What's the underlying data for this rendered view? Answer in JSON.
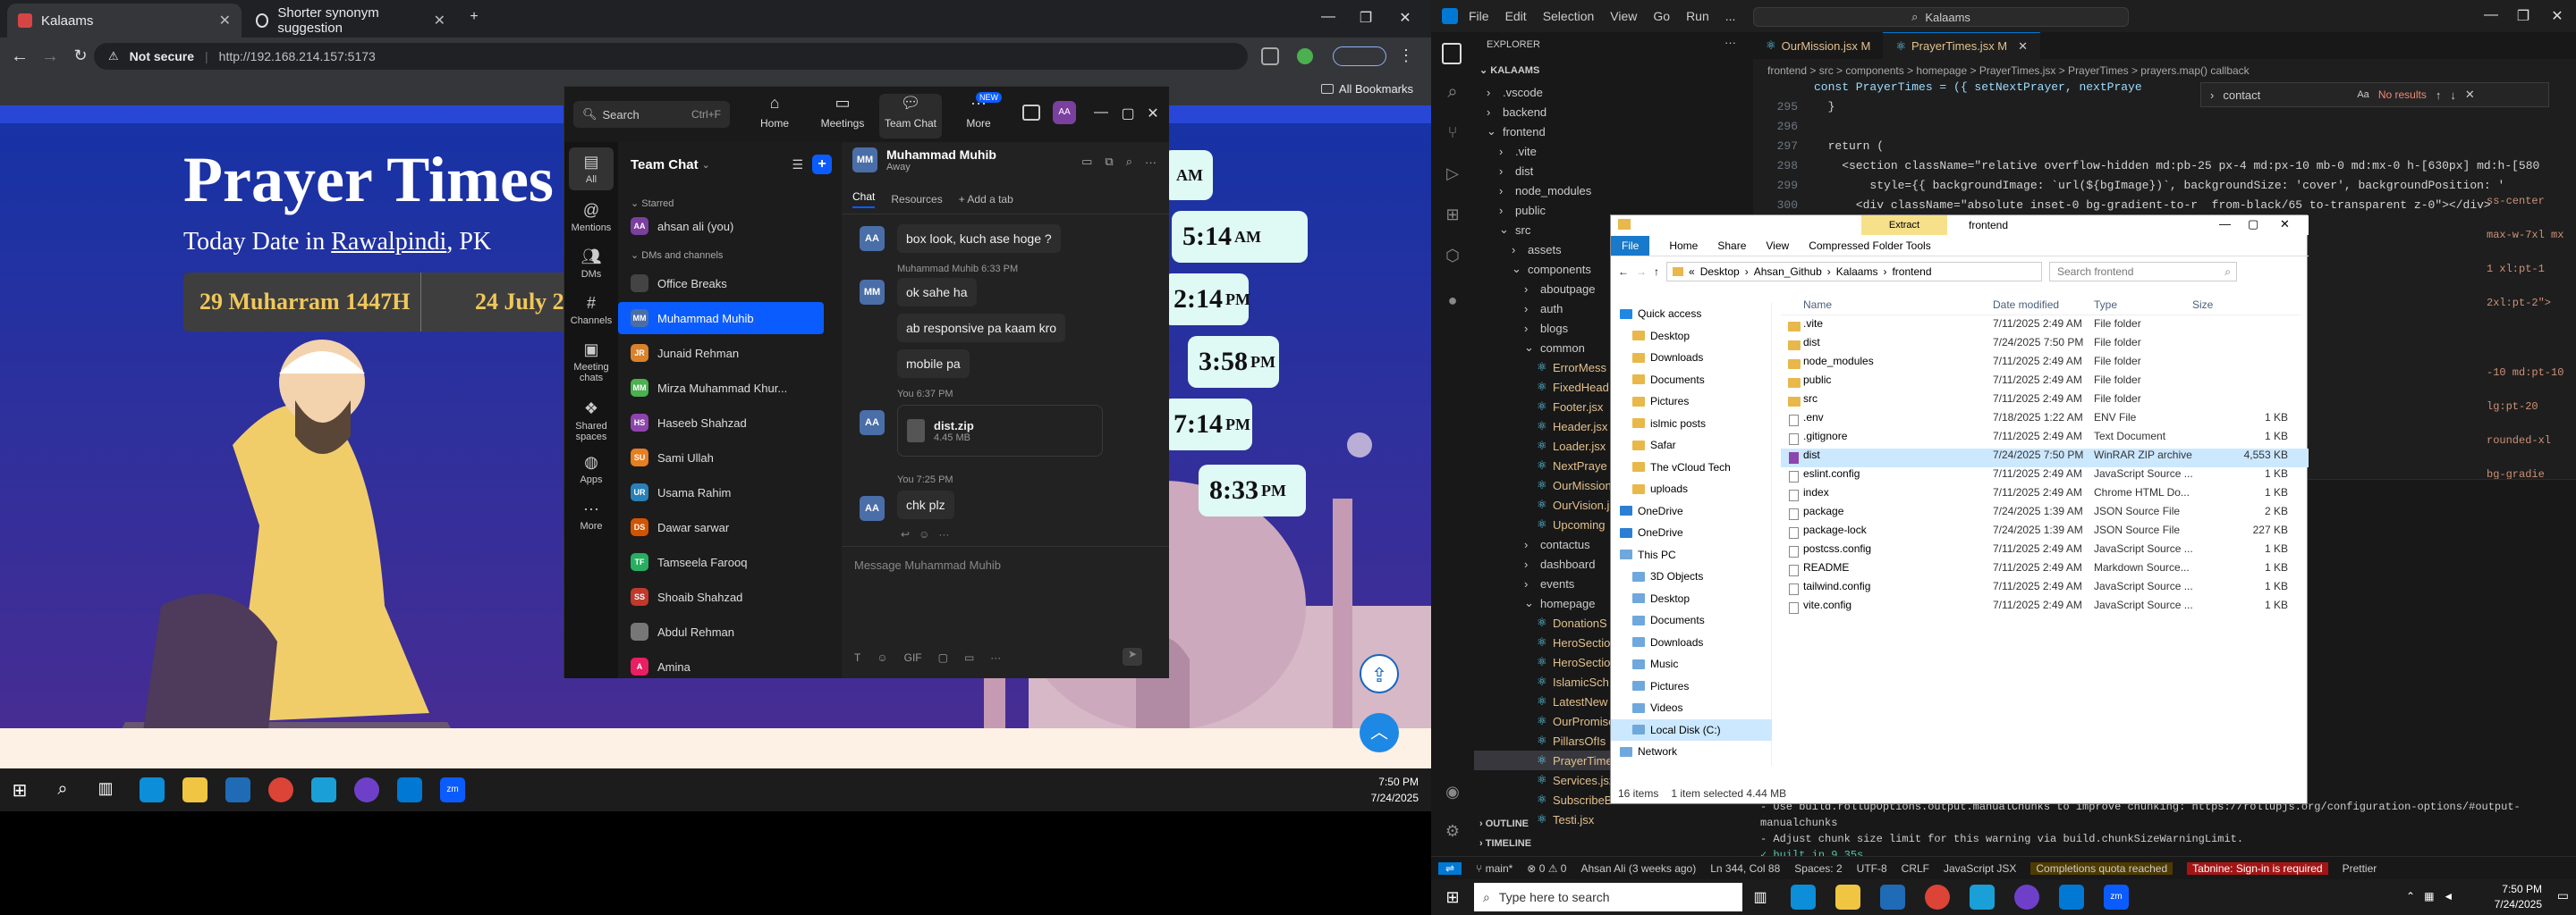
{
  "chrome": {
    "tabs": [
      {
        "title": "Kalaams",
        "active": true
      },
      {
        "title": "Shorter synonym suggestion",
        "active": false
      }
    ],
    "not_secure": "Not secure",
    "url": "http://192.168.214.157:5173",
    "all_bookmarks": "All Bookmarks"
  },
  "site": {
    "title": "Prayer Times",
    "date_prefix": "Today Date in ",
    "city": "Rawalpindi",
    "country": ", PK",
    "hijri": "29 Muharram 1447H",
    "gregorian": "24 July 2",
    "times": [
      {
        "t": "",
        "ampm": "AM"
      },
      {
        "t": "5:14",
        "ampm": "AM"
      },
      {
        "t": "2:14",
        "ampm": "PM"
      },
      {
        "t": "3:58",
        "ampm": "PM"
      },
      {
        "t": "7:14",
        "ampm": "PM"
      },
      {
        "t": "8:33",
        "ampm": "PM"
      }
    ]
  },
  "zoom": {
    "search": "Search",
    "search_shortcut": "Ctrl+F",
    "nav": [
      "Home",
      "Meetings",
      "Team Chat",
      "More"
    ],
    "new_badge": "NEW",
    "rail": [
      "All",
      "Mentions",
      "DMs",
      "Channels",
      "Meeting chats",
      "Shared spaces",
      "Apps",
      "More"
    ],
    "list_title": "Team Chat",
    "starred": "Starred",
    "me": "ahsan ali (you)",
    "dms_channels": "DMs and channels",
    "contacts": [
      {
        "name": "Office Breaks",
        "initials": "",
        "color": "#444"
      },
      {
        "name": "Muhammad Muhib",
        "initials": "MM",
        "color": "#4a6ea8"
      },
      {
        "name": "Junaid Rehman",
        "initials": "JR",
        "color": "#d9822b"
      },
      {
        "name": "Mirza Muhammad Khur...",
        "initials": "MM",
        "color": "#4caf50"
      },
      {
        "name": "Haseeb Shahzad",
        "initials": "HS",
        "color": "#8e44ad"
      },
      {
        "name": "Sami Ullah",
        "initials": "SU",
        "color": "#e67e22"
      },
      {
        "name": "Usama Rahim",
        "initials": "UR",
        "color": "#2980b9"
      },
      {
        "name": "Dawar sarwar",
        "initials": "DS",
        "color": "#d35400"
      },
      {
        "name": "Tamseela Farooq",
        "initials": "TF",
        "color": "#27ae60"
      },
      {
        "name": "Shoaib Shahzad",
        "initials": "SS",
        "color": "#c0392b"
      },
      {
        "name": "Abdul Rehman",
        "initials": "",
        "color": "#777"
      },
      {
        "name": "Amina",
        "initials": "A",
        "color": "#e91e63"
      }
    ],
    "chat_name": "Muhammad Muhib",
    "chat_status": "Away",
    "chat_tabs": [
      "Chat",
      "Resources",
      "Add a tab"
    ],
    "messages": [
      {
        "text": "box look, kuch ase hoge ?"
      },
      {
        "meta": "Muhammad Muhib 6:33 PM"
      },
      {
        "text": "ok sahe ha"
      },
      {
        "text": "ab responsive pa kaam kro"
      },
      {
        "text": "mobile pa"
      },
      {
        "meta": "You 6:37 PM"
      },
      {
        "file": "dist.zip",
        "size": "4.45 MB"
      },
      {
        "meta": "You 7:25 PM"
      },
      {
        "text": "chk plz"
      }
    ],
    "composer": "Message Muhammad Muhib"
  },
  "vscode": {
    "menu": [
      "File",
      "Edit",
      "Selection",
      "View",
      "Go",
      "Run",
      "..."
    ],
    "command": "Kalaams",
    "explorer_title": "EXPLORER",
    "root": "KALAAMS",
    "tree": [
      {
        "n": ".vscode",
        "d": 1,
        "f": true
      },
      {
        "n": "backend",
        "d": 1,
        "f": true
      },
      {
        "n": "frontend",
        "d": 1,
        "f": true,
        "open": true
      },
      {
        "n": ".vite",
        "d": 2,
        "f": true
      },
      {
        "n": "dist",
        "d": 2,
        "f": true
      },
      {
        "n": "node_modules",
        "d": 2,
        "f": true
      },
      {
        "n": "public",
        "d": 2,
        "f": true
      },
      {
        "n": "src",
        "d": 2,
        "f": true,
        "open": true
      },
      {
        "n": "assets",
        "d": 3,
        "f": true
      },
      {
        "n": "components",
        "d": 3,
        "f": true,
        "open": true
      },
      {
        "n": "aboutpage",
        "d": 4,
        "f": true
      },
      {
        "n": "auth",
        "d": 4,
        "f": true
      },
      {
        "n": "blogs",
        "d": 4,
        "f": true
      },
      {
        "n": "common",
        "d": 4,
        "f": true,
        "open": true
      },
      {
        "n": "ErrorMess",
        "d": 5
      },
      {
        "n": "FixedHead",
        "d": 5
      },
      {
        "n": "Footer.jsx",
        "d": 5
      },
      {
        "n": "Header.jsx",
        "d": 5
      },
      {
        "n": "Loader.jsx",
        "d": 5
      },
      {
        "n": "NextPraye",
        "d": 5
      },
      {
        "n": "OurMission",
        "d": 5
      },
      {
        "n": "OurVision.j",
        "d": 5
      },
      {
        "n": "Upcoming",
        "d": 5
      },
      {
        "n": "contactus",
        "d": 4,
        "f": true
      },
      {
        "n": "dashboard",
        "d": 4,
        "f": true
      },
      {
        "n": "events",
        "d": 4,
        "f": true
      },
      {
        "n": "homepage",
        "d": 4,
        "f": true,
        "open": true
      },
      {
        "n": "DonationS",
        "d": 5
      },
      {
        "n": "HeroSectio",
        "d": 5
      },
      {
        "n": "HeroSectio",
        "d": 5
      },
      {
        "n": "IslamicSch",
        "d": 5
      },
      {
        "n": "LatestNew",
        "d": 5
      },
      {
        "n": "OurPromise",
        "d": 5
      },
      {
        "n": "PillarsOfIs",
        "d": 5
      },
      {
        "n": "PrayerTime",
        "d": 5,
        "sel": true
      },
      {
        "n": "Services.jsx",
        "d": 5
      },
      {
        "n": "SubscribeB",
        "d": 5
      },
      {
        "n": "Testi.jsx",
        "d": 5
      }
    ],
    "outline": "OUTLINE",
    "timeline": "TIMELINE",
    "tabs": [
      "OurMission.jsx M",
      "PrayerTimes.jsx M"
    ],
    "breadcrumb": "frontend > src > components > homepage > PrayerTimes.jsx > PrayerTimes > prayers.map() callback",
    "find_value": "contact",
    "find_result": "No results",
    "code": [
      {
        "ln": "",
        "t": "const PrayerTimes = ({ setNextPrayer, nextPraye"
      },
      {
        "ln": "295",
        "t": "  }"
      },
      {
        "ln": "296",
        "t": ""
      },
      {
        "ln": "297",
        "t": "  return ("
      },
      {
        "ln": "298",
        "t": "    <section className=\"relative overflow-hidden md:pb-25 px-4 md:px-10 mb-0 md:mx-0 h-[630px] md:h-[580"
      },
      {
        "ln": "299",
        "t": "        style={{ backgroundImage: `url(${bgImage})`, backgroundSize: 'cover', backgroundPosition: '"
      },
      {
        "ln": "300",
        "t": "      <div className=\"absolute inset-0 bg-gradient-to-r  from-black/65 to-transparent z-0\"></div>"
      }
    ],
    "code_right": [
      "ss-center max-w-7xl mx",
      "1 xl:pt-1 2xl:pt-2\">",
      "-10 md:pt-10 lg:pt-20",
      "rounded-xl bg-gradie"
    ],
    "terminal": [
      "- Use build.rollupOptions.output.manualChunks to improve chunking: https://rollupjs.org/configuration-options/#output-manualchunks",
      "- Adjust chunk size limit for this warning via build.chunkSizeWarningLimit.",
      "✓ built in 9.35s",
      "PS C:\\Users\\ahsan.ali\\Desktop\\Ahsan_Github\\Kalaams\\frontend> "
    ],
    "status": {
      "branch": "main*",
      "errors": "0 ⚠ 0",
      "blame": "Ahsan Ali (3 weeks ago)",
      "pos": "Ln 344, Col 88",
      "spaces": "Spaces: 2",
      "enc": "UTF-8",
      "eol": "CRLF",
      "lang": "JavaScript JSX",
      "quota": "Completions quota reached",
      "tabnine": "Tabnine: Sign-in is required",
      "prettier": "Prettier"
    }
  },
  "explorer": {
    "title": "frontend",
    "extract": "Extract",
    "ribbon": [
      "File",
      "Home",
      "Share",
      "View",
      "Compressed Folder Tools"
    ],
    "path": [
      "Desktop",
      "Ahsan_Github",
      "Kalaams",
      "frontend"
    ],
    "search": "Search frontend",
    "nav": [
      "Quick access",
      "Desktop",
      "Downloads",
      "Documents",
      "Pictures",
      "islmic posts",
      "Safar",
      "The vCloud Tech",
      "uploads",
      "OneDrive",
      "OneDrive",
      "This PC",
      "3D Objects",
      "Desktop",
      "Documents",
      "Downloads",
      "Music",
      "Pictures",
      "Videos",
      "Local Disk (C:)",
      "Network"
    ],
    "columns": [
      "Name",
      "Date modified",
      "Type",
      "Size"
    ],
    "files": [
      {
        "n": ".vite",
        "d": "7/11/2025 2:49 AM",
        "t": "File folder",
        "s": "",
        "folder": true
      },
      {
        "n": "dist",
        "d": "7/24/2025 7:50 PM",
        "t": "File folder",
        "s": "",
        "folder": true
      },
      {
        "n": "node_modules",
        "d": "7/11/2025 2:49 AM",
        "t": "File folder",
        "s": "",
        "folder": true
      },
      {
        "n": "public",
        "d": "7/11/2025 2:49 AM",
        "t": "File folder",
        "s": "",
        "folder": true
      },
      {
        "n": "src",
        "d": "7/11/2025 2:49 AM",
        "t": "File folder",
        "s": "",
        "folder": true
      },
      {
        "n": ".env",
        "d": "7/18/2025 1:22 AM",
        "t": "ENV File",
        "s": "1 KB"
      },
      {
        "n": ".gitignore",
        "d": "7/11/2025 2:49 AM",
        "t": "Text Document",
        "s": "1 KB"
      },
      {
        "n": "dist",
        "d": "7/24/2025 7:50 PM",
        "t": "WinRAR ZIP archive",
        "s": "4,553 KB",
        "sel": true
      },
      {
        "n": "eslint.config",
        "d": "7/11/2025 2:49 AM",
        "t": "JavaScript Source ...",
        "s": "1 KB"
      },
      {
        "n": "index",
        "d": "7/11/2025 2:49 AM",
        "t": "Chrome HTML Do...",
        "s": "1 KB"
      },
      {
        "n": "package",
        "d": "7/24/2025 1:39 AM",
        "t": "JSON Source File",
        "s": "2 KB"
      },
      {
        "n": "package-lock",
        "d": "7/24/2025 1:39 AM",
        "t": "JSON Source File",
        "s": "227 KB"
      },
      {
        "n": "postcss.config",
        "d": "7/11/2025 2:49 AM",
        "t": "JavaScript Source ...",
        "s": "1 KB"
      },
      {
        "n": "README",
        "d": "7/11/2025 2:49 AM",
        "t": "Markdown Source...",
        "s": "1 KB"
      },
      {
        "n": "tailwind.config",
        "d": "7/11/2025 2:49 AM",
        "t": "JavaScript Source ...",
        "s": "1 KB"
      },
      {
        "n": "vite.config",
        "d": "7/11/2025 2:49 AM",
        "t": "JavaScript Source ...",
        "s": "1 KB"
      }
    ],
    "status_items": "16 items",
    "status_sel": "1 item selected  4.44 MB"
  },
  "taskbar_left": {
    "time": "7:50 PM",
    "date": "7/24/2025"
  },
  "taskbar_right": {
    "search": "Type here to search",
    "time": "7:50 PM",
    "date": "7/24/2025"
  }
}
